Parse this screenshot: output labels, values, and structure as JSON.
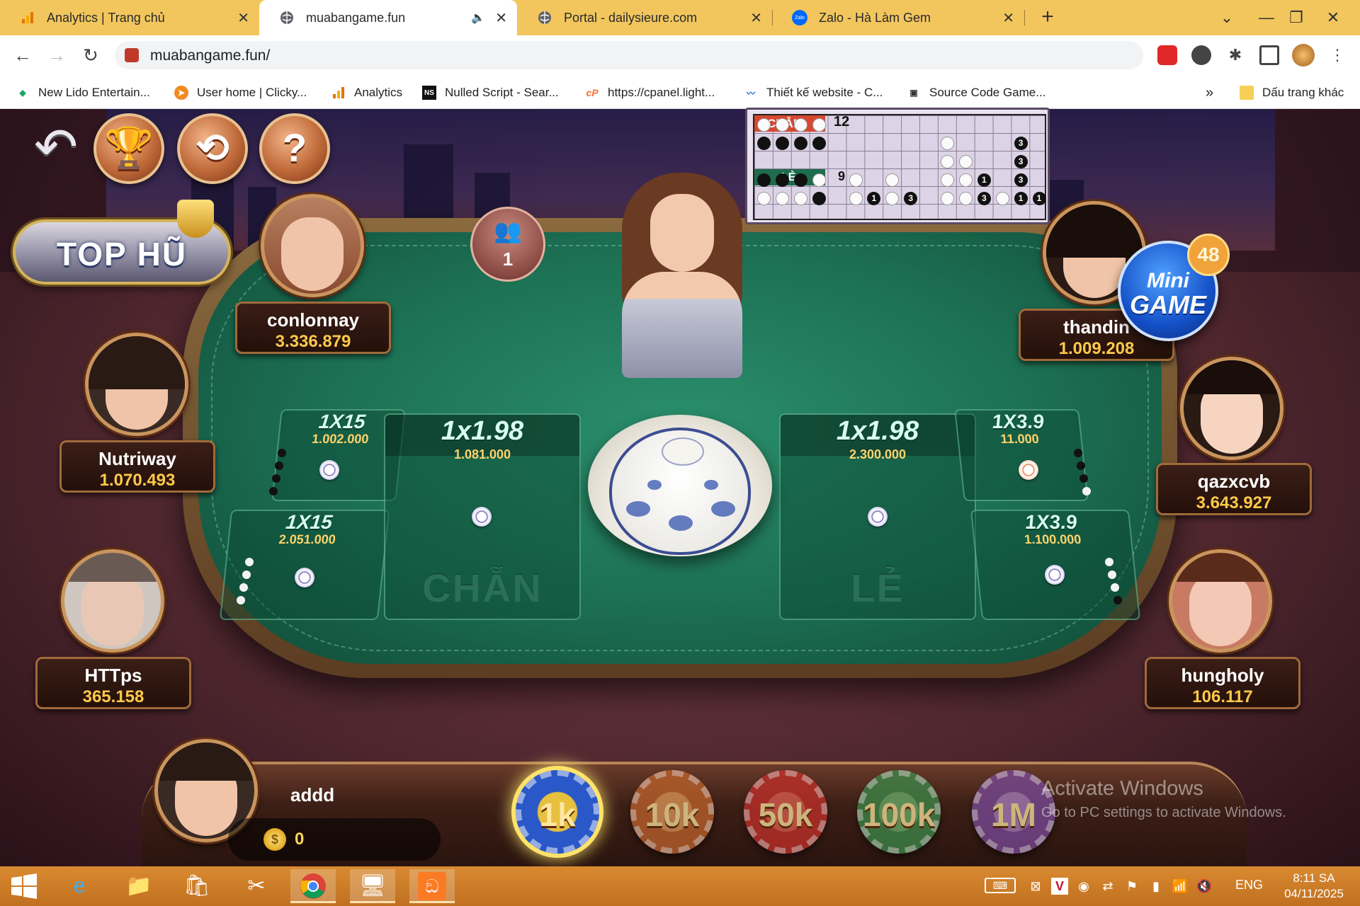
{
  "browser": {
    "tabs": [
      {
        "label": "Analytics | Trang chủ",
        "icon": "analytics-icon"
      },
      {
        "label": "muabangame.fun",
        "icon": "globe-icon",
        "audio": true
      },
      {
        "label": "Portal - dailysieure.com",
        "icon": "globe-icon"
      },
      {
        "label": "Zalo - Hà Làm Gem",
        "icon": "zalo-icon",
        "icon_text": "Zalo"
      }
    ],
    "new_tab": "+",
    "url": "muabangame.fun/",
    "bookmarks": [
      {
        "label": "New Lido Entertain...",
        "icon": "lido-icon"
      },
      {
        "label": "User home | Clicky...",
        "icon": "clicky-icon"
      },
      {
        "label": "Analytics",
        "icon": "analytics-icon"
      },
      {
        "label": "Nulled Script - Sear...",
        "icon": "ns-icon",
        "icon_text": "NS"
      },
      {
        "label": "https://cpanel.light...",
        "icon": "cpanel-icon",
        "icon_text": "cP"
      },
      {
        "label": "Thiết kế website - C...",
        "icon": "web-design-icon"
      },
      {
        "label": "Source Code Game...",
        "icon": "source-code-icon"
      }
    ],
    "more": "»",
    "other_bookmarks": "Dấu trang khác"
  },
  "game": {
    "players_online": "1",
    "top_hu_label": "TOP HŨ",
    "minigame": {
      "line1": "Mini",
      "line2": "GAME",
      "badge": "48"
    },
    "history": {
      "chan_label": "CHẴN",
      "chan_count": "12",
      "le_label": "LẺ",
      "le_count": "9"
    },
    "bets": {
      "chan_4w": {
        "odds": "1X15",
        "amount": "1.002.000"
      },
      "chan_4b": {
        "odds": "1X15",
        "amount": "2.051.000"
      },
      "chan": {
        "odds": "1x1.98",
        "amount": "1.081.000",
        "label": "CHẴN"
      },
      "le": {
        "odds": "1x1.98",
        "amount": "2.300.000",
        "label": "LẺ"
      },
      "le_3b": {
        "odds": "1X3.9",
        "amount": "11.000"
      },
      "le_3w": {
        "odds": "1X3.9",
        "amount": "1.100.000"
      }
    },
    "players": [
      {
        "name": "conlonnay",
        "balance": "3.336.879"
      },
      {
        "name": "Nutriway",
        "balance": "1.070.493"
      },
      {
        "name": "HTTps",
        "balance": "365.158"
      },
      {
        "name": "thandin",
        "balance": "1.009.208"
      },
      {
        "name": "qazxcvb",
        "balance": "3.643.927"
      },
      {
        "name": "hungholy",
        "balance": "106.117"
      }
    ],
    "self": {
      "name": "addd",
      "coins": "0",
      "coin_symbol": "$"
    },
    "chips": [
      {
        "label": "1k",
        "color": "#2a58c8",
        "selected": true
      },
      {
        "label": "10k",
        "color": "#c0632c"
      },
      {
        "label": "50k",
        "color": "#c4302a"
      },
      {
        "label": "100k",
        "color": "#3c8a4a"
      },
      {
        "label": "1M",
        "color": "#7b4a9a"
      }
    ]
  },
  "watermark": {
    "line1": "Activate Windows",
    "line2": "Go to PC settings to activate Windows."
  },
  "taskbar": {
    "lang": "ENG",
    "time": "8:11 SA",
    "date": "04/11/2025"
  },
  "colors": {
    "tabbar": "#f2c65d",
    "felt": "#1c6e52",
    "taskbar": "#c97a28",
    "gold": "#ffc94a"
  }
}
